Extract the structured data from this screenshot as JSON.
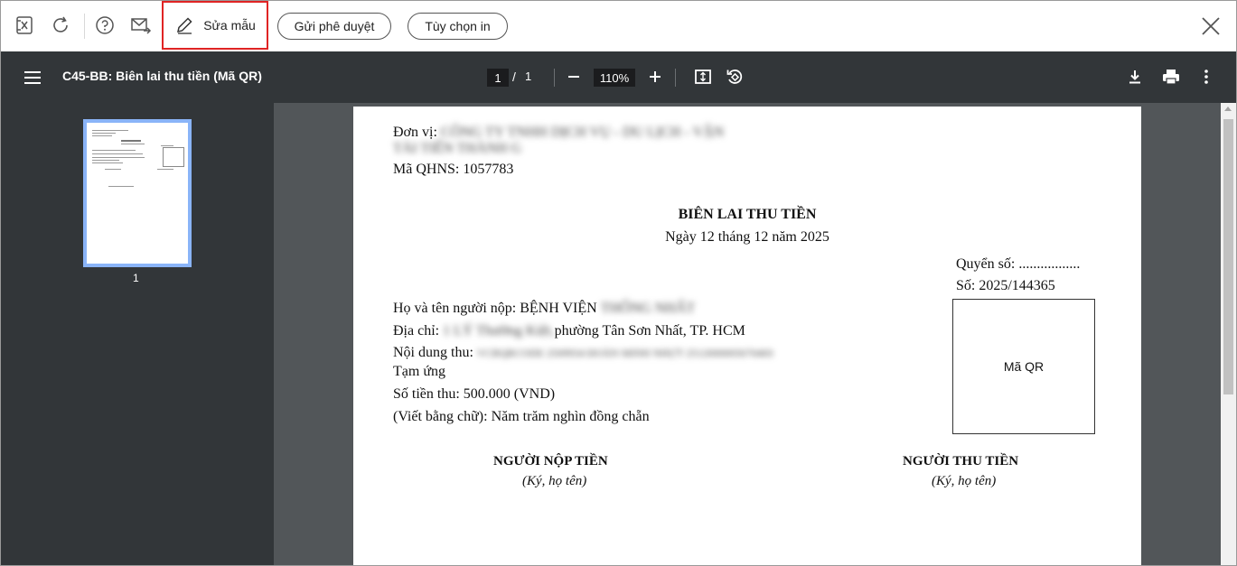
{
  "toolbar": {
    "edit_label": "Sửa mẫu",
    "send_approval_label": "Gửi phê duyệt",
    "print_options_label": "Tùy chọn in",
    "accent_color": "#e02424"
  },
  "viewer": {
    "title": "C45-BB: Biên lai thu tiền (Mã QR)",
    "current_page": "1",
    "page_sep": "/",
    "total_pages": "1",
    "zoom": "110%",
    "thumbnail_label": "1"
  },
  "document": {
    "unit_label": "Đơn vị:",
    "unit_value": "CÔNG TY TNHH DỊCH VỤ - DU LỊCH - VẬN",
    "unit_value2": "TẢI TIẾN THÀNH G",
    "qhns": "Mã QHNS: 1057783",
    "title": "BIÊN LAI THU TIỀN",
    "date": "Ngày 12 tháng 12 năm 2025",
    "book_no": "Quyển số: .................",
    "serial_no": "Số: 2025/144365",
    "payer_label": "Họ và tên người nộp: BỆNH VIỆN",
    "payer_blur": "THỐNG NHẤT",
    "address_label": "Địa chỉ:",
    "address_blur": "1 LÝ Thường Kiệt,",
    "address_rest": "phường Tân Sơn Nhất, TP. HCM",
    "content_label": "Nội dung thu:",
    "content_blur": "VCBQRCODE 2509934 ĐOÀN MINH NHỰT 251200000567046S",
    "content_line2": "Tạm ứng",
    "amount": "Số tiền thu: 500.000 (VND)",
    "amount_words": "(Viết bằng chữ): Năm trăm nghìn đồng chẵn",
    "qr_label": "Mã QR",
    "payer_sign_title": "NGƯỜI NỘP TIỀN",
    "payer_sign_sub": "(Ký, họ tên)",
    "collector_sign_title": "NGƯỜI THU TIỀN",
    "collector_sign_sub": "(Ký, họ tên)"
  }
}
